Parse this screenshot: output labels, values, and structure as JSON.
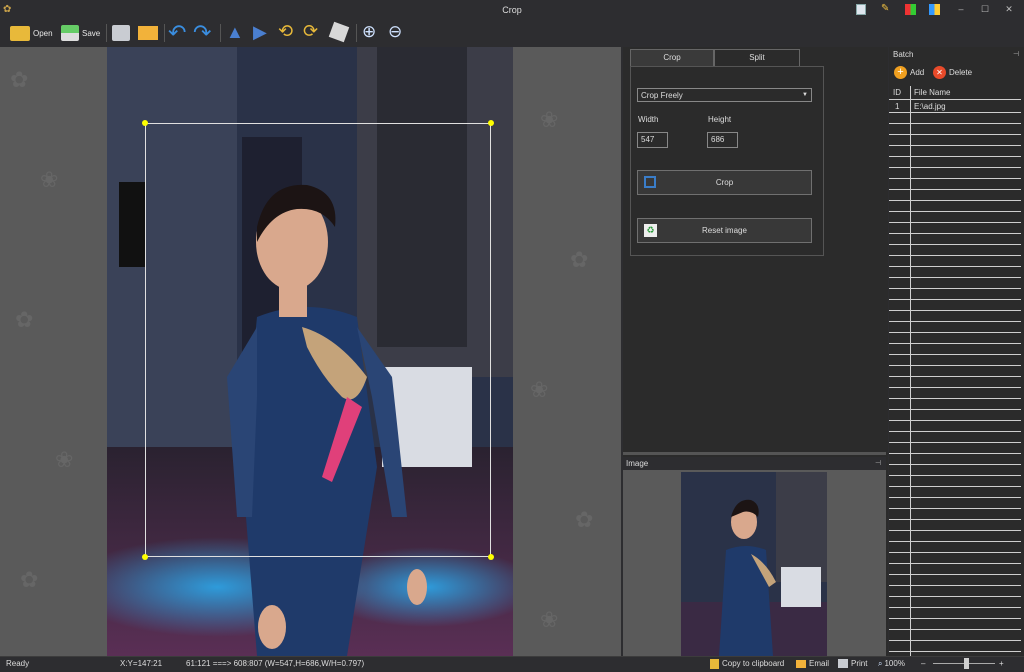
{
  "window": {
    "title": "Crop",
    "controls": [
      "–",
      "☐",
      "✕"
    ]
  },
  "toolbar": {
    "open_label": "Open",
    "save_label": "Save"
  },
  "crop_tabs": [
    "Crop",
    "Split"
  ],
  "crop_panel": {
    "mode": "Crop Freely",
    "width_label": "Width",
    "height_label": "Height",
    "width_value": "547",
    "height_value": "686",
    "crop_button": "Crop",
    "reset_button": "Reset image"
  },
  "image_panel": {
    "title": "Image"
  },
  "batch": {
    "title": "Batch",
    "add_label": "Add",
    "delete_label": "Delete",
    "columns": [
      "ID",
      "File Name"
    ],
    "rows": [
      {
        "id": "1",
        "name": "E:\\ad.jpg"
      }
    ]
  },
  "status": {
    "ready": "Ready",
    "xy": "X:Y=147:21",
    "selection": "61:121 ===> 608:807 (W=547,H=686,W/H=0.797)",
    "copy_label": "Copy to clipboard",
    "email_label": "Email",
    "print_label": "Print",
    "zoom": "100%",
    "zoom_minus": "–",
    "zoom_plus": "+"
  },
  "colors": {
    "background": "#2d2d30",
    "canvas": "#5a5a5a",
    "handle": "#ffff00",
    "accent_blue": "#3a7dc9"
  },
  "zoom_level": 0.55
}
